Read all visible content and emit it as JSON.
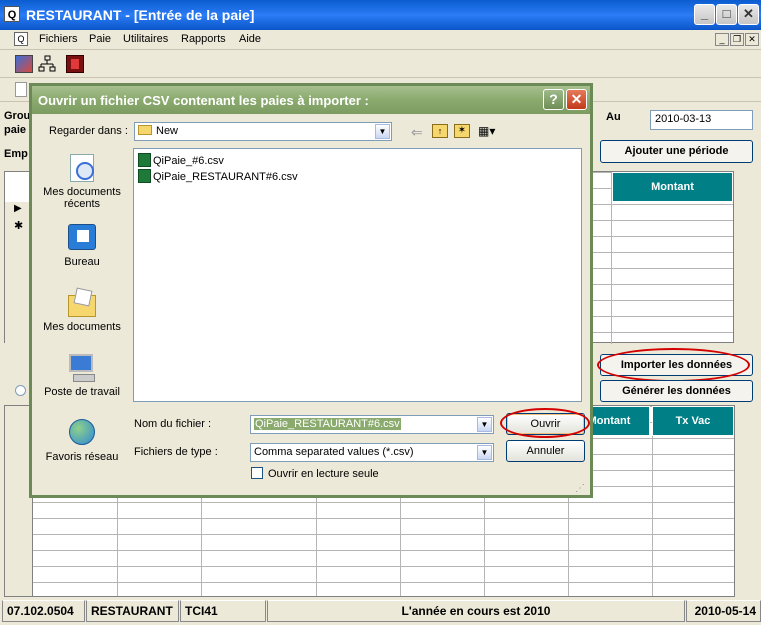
{
  "window": {
    "title": "RESTAURANT - [Entrée de la paie]",
    "app_icon": "Q"
  },
  "menu": [
    "Fichiers",
    "Paie",
    "Utilitaires",
    "Rapports",
    "Aide"
  ],
  "form": {
    "group_label_1": "Grou",
    "group_label_2": "paie",
    "emp_label": "Emp",
    "au_label": "Au",
    "au_value": "2010-03-13",
    "add_period_button": "Ajouter une période",
    "import_button": "Importer les données",
    "generate_button": "Générer les données",
    "top_grid_header": "Montant",
    "bottom_grid_headers": [
      "Montant",
      "Tx Vac"
    ],
    "row_marker_current": "▶",
    "row_marker_new": "✱"
  },
  "dialog": {
    "title": "Ouvrir un fichier CSV contenant les paies à importer :",
    "look_in_label": "Regarder dans :",
    "look_in_value": "New",
    "places": [
      "Mes documents récents",
      "Bureau",
      "Mes documents",
      "Poste de travail",
      "Favoris réseau"
    ],
    "files": [
      "QiPaie_#6.csv",
      "QiPaie_RESTAURANT#6.csv"
    ],
    "filename_label": "Nom du fichier :",
    "filename_value": "QiPaie_RESTAURANT#6.csv",
    "filetype_label": "Fichiers de type :",
    "filetype_value": "Comma separated values (*.csv)",
    "readonly_label": "Ouvrir en lecture seule",
    "open_button": "Ouvrir",
    "cancel_button": "Annuler",
    "help_button": "?",
    "close_button": "✕"
  },
  "statusbar": {
    "version": "07.102.0504",
    "company": "RESTAURANT",
    "code": "TCI41",
    "message": "L'année en cours est 2010",
    "date": "2010-05-14"
  },
  "colors": {
    "titlebar": "#0a5ccf",
    "dialog_title": "#8aaa6e",
    "grid_header": "#007f86",
    "highlight_ellipse": "#d40000"
  }
}
